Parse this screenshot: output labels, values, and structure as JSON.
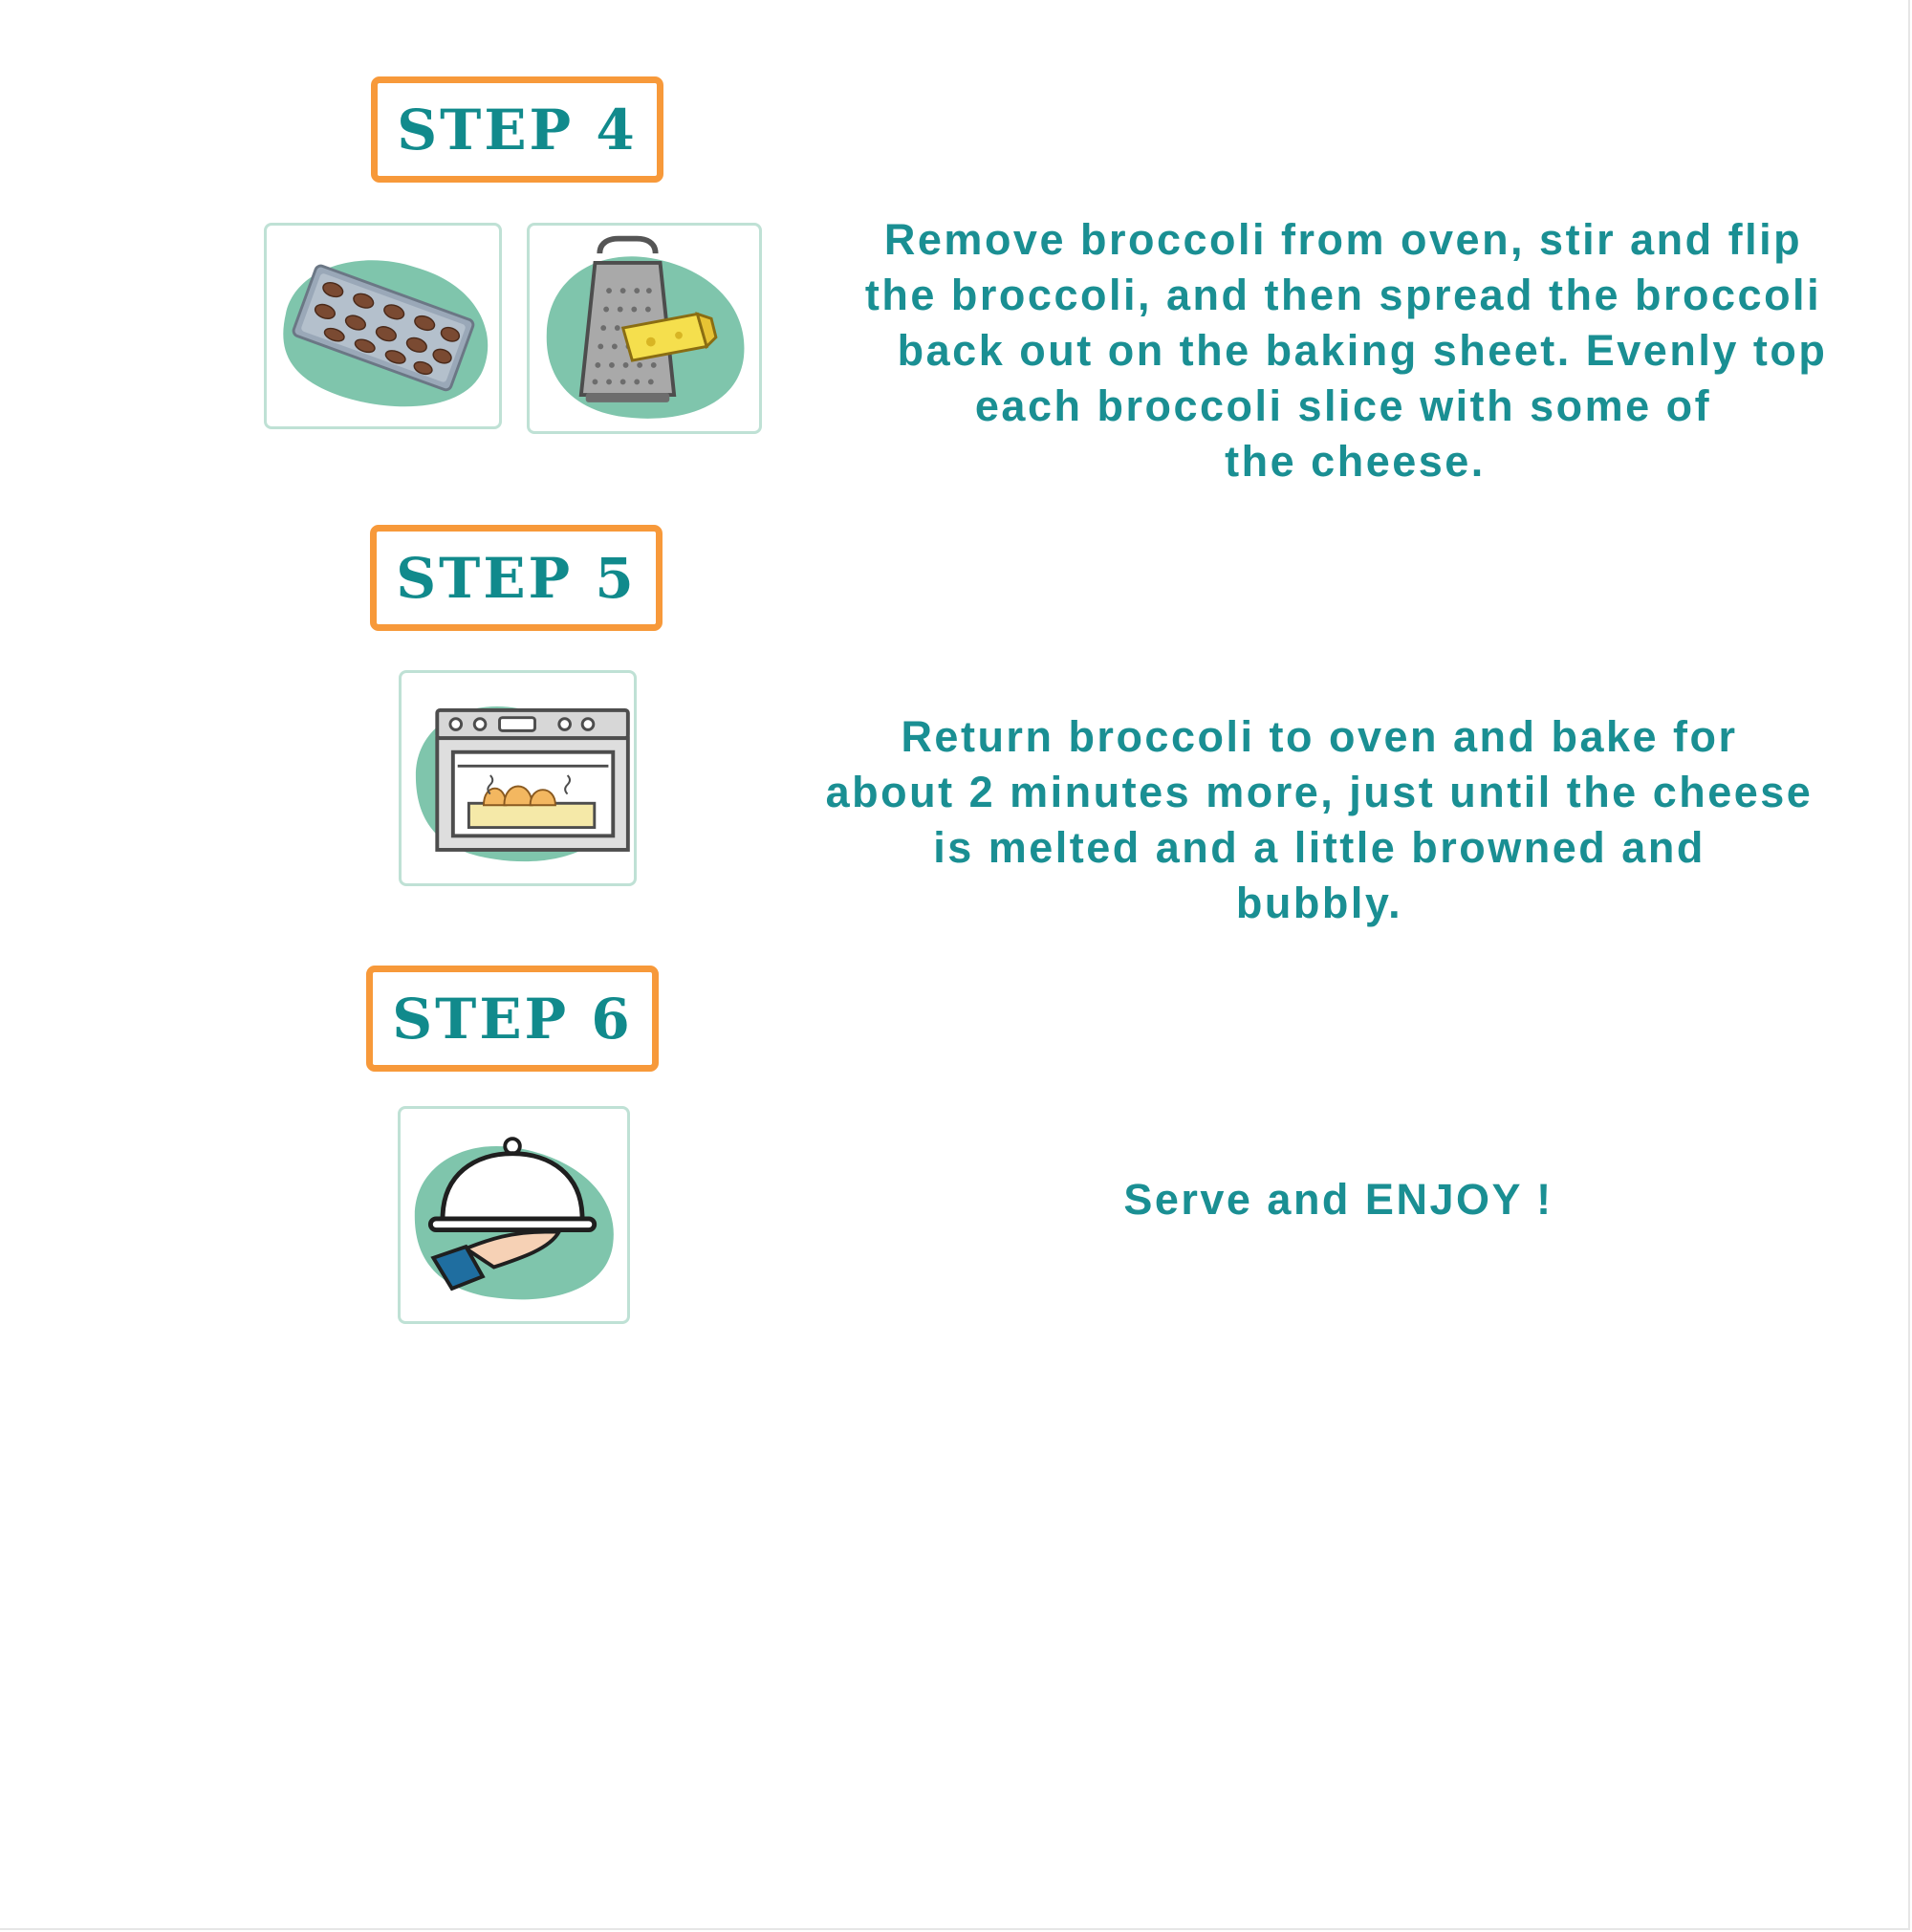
{
  "steps": [
    {
      "label": "STEP 4",
      "icons": [
        "baking-sheet-icon",
        "cheese-grater-icon"
      ],
      "lines": [
        "Remove broccoli from oven, stir and flip",
        "the broccoli, and then spread the broccoli",
        "back out on the baking sheet. Evenly top",
        "each broccoli slice with some of",
        "the cheese."
      ]
    },
    {
      "label": "STEP 5",
      "icons": [
        "oven-icon"
      ],
      "lines": [
        "Return broccoli to oven and bake for",
        "about 2 minutes more, just until the cheese",
        "is melted and a little browned and",
        "bubbly."
      ]
    },
    {
      "label": "STEP 6",
      "icons": [
        "serving-cloche-icon"
      ],
      "lines": [
        "Serve and ENJOY !"
      ]
    }
  ],
  "colors": {
    "badge_border": "#f7993a",
    "title_text": "#118a8c",
    "instruction_text": "#1a8f93",
    "icon_blob": "#7fc5ac",
    "card_border": "#bfe1d5"
  }
}
